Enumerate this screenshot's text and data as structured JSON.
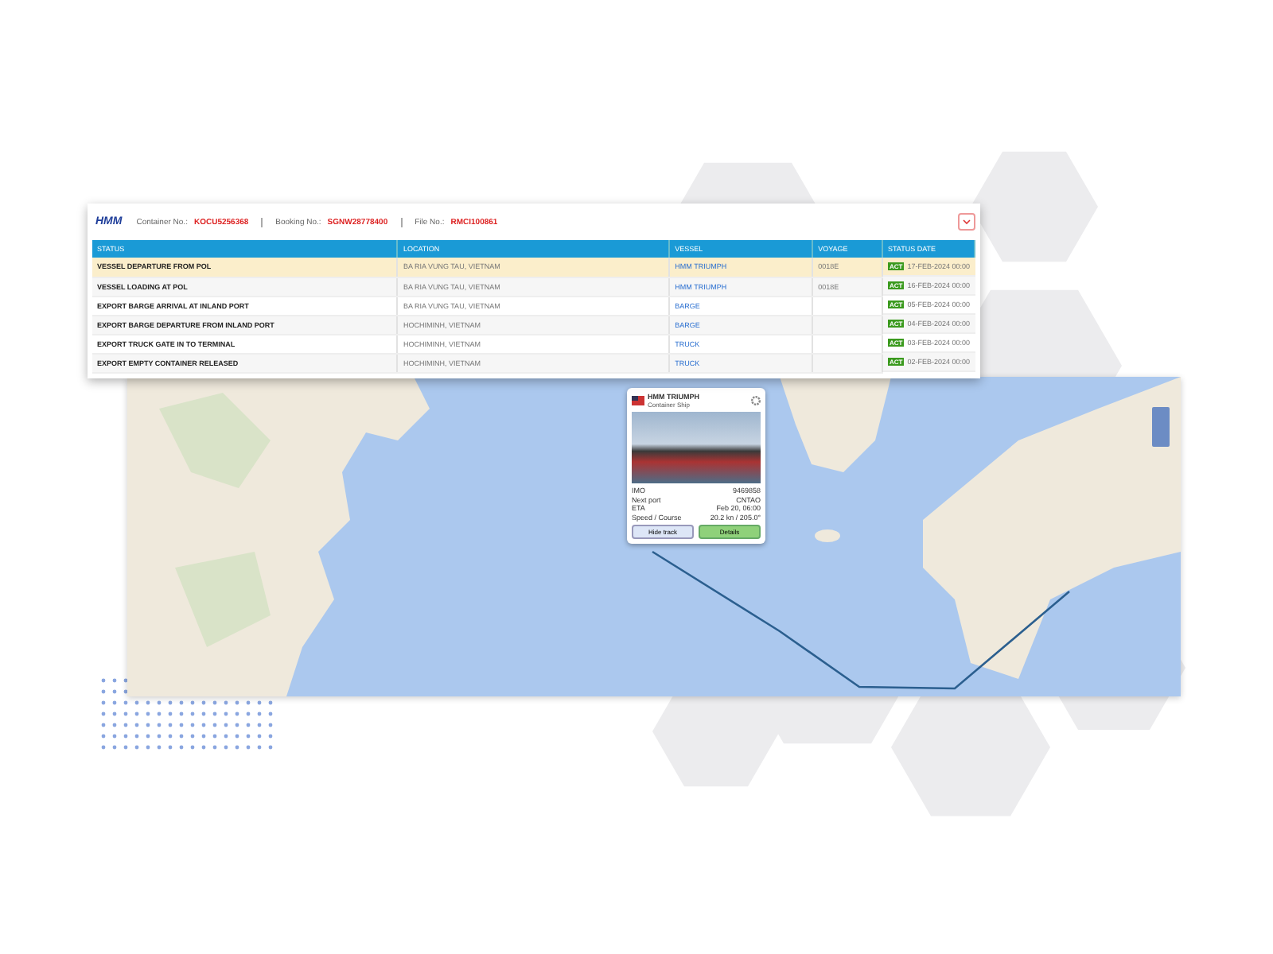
{
  "header": {
    "logo": "HMM",
    "fields": [
      {
        "label": "Container No.:",
        "value": "KOCU5256368"
      },
      {
        "label": "Booking No.:",
        "value": "SGNW28778400"
      },
      {
        "label": "File No.:",
        "value": "RMCI100861"
      }
    ]
  },
  "table": {
    "columns": [
      "STATUS",
      "LOCATION",
      "VESSEL",
      "VOYAGE",
      "STATUS DATE"
    ],
    "rows": [
      {
        "status": "VESSEL DEPARTURE FROM POL",
        "location": "BA RIA VUNG TAU, VIETNAM",
        "vessel": "HMM TRIUMPH",
        "voyage": "0018E",
        "badge": "ACT",
        "date": "17-FEB-2024 00:00",
        "selected": true
      },
      {
        "status": "VESSEL LOADING AT POL",
        "location": "BA RIA VUNG TAU, VIETNAM",
        "vessel": "HMM TRIUMPH",
        "voyage": "0018E",
        "badge": "ACT",
        "date": "16-FEB-2024 00:00",
        "selected": false
      },
      {
        "status": "EXPORT BARGE ARRIVAL AT INLAND PORT",
        "location": "BA RIA VUNG TAU, VIETNAM",
        "vessel": "BARGE",
        "voyage": "",
        "badge": "ACT",
        "date": "05-FEB-2024 00:00",
        "selected": false
      },
      {
        "status": "EXPORT BARGE DEPARTURE FROM INLAND PORT",
        "location": "HOCHIMINH, VIETNAM",
        "vessel": "BARGE",
        "voyage": "",
        "badge": "ACT",
        "date": "04-FEB-2024 00:00",
        "selected": false
      },
      {
        "status": "EXPORT TRUCK GATE IN TO TERMINAL",
        "location": "HOCHIMINH, VIETNAM",
        "vessel": "TRUCK",
        "voyage": "",
        "badge": "ACT",
        "date": "03-FEB-2024 00:00",
        "selected": false
      },
      {
        "status": "EXPORT EMPTY CONTAINER RELEASED",
        "location": "HOCHIMINH, VIETNAM",
        "vessel": "TRUCK",
        "voyage": "",
        "badge": "ACT",
        "date": "02-FEB-2024 00:00",
        "selected": false
      }
    ]
  },
  "popup": {
    "title": "HMM TRIUMPH",
    "subtitle": "Container Ship",
    "details": [
      {
        "label": "IMO",
        "value": "9469858"
      },
      {
        "label": "Next port",
        "value": "CNTAO"
      },
      {
        "label": "ETA",
        "value": "Feb 20, 06:00"
      },
      {
        "label": "Speed / Course",
        "value": "20.2 kn / 205.0°"
      }
    ],
    "buttons": [
      {
        "label": "Hide track",
        "kind": "secondary"
      },
      {
        "label": "Details",
        "kind": "primary"
      }
    ]
  }
}
